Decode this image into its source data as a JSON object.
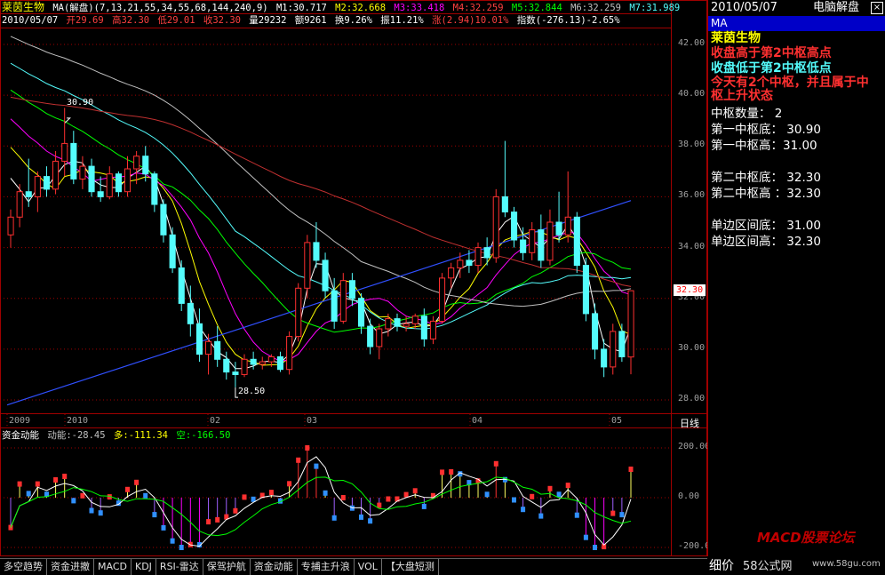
{
  "stock_name": "莱茵生物",
  "indicator_header": {
    "label": "MA(解盘)(7,13,21,55,34,55,68,144,240,9)",
    "m1": "M1:30.717",
    "m2": "M2:32.668",
    "m3": "M3:33.418",
    "m4": "M4:32.259",
    "m5": "M5:32.844",
    "m6": "M6:32.259",
    "m7": "M7:31.989"
  },
  "quote_line": {
    "date": "2010/05/07",
    "open": "开29.69",
    "high": "高32.30",
    "low": "低29.01",
    "close": "收32.30",
    "volume": "量29232",
    "amount": "额9261",
    "turnover": "换9.26%",
    "amplitude": "振11.21%",
    "change": "涨(2.94)10.01%",
    "index": "指数(-276.13)-2.65%"
  },
  "price_axis": [
    "42.00",
    "40.00",
    "38.00",
    "36.00",
    "34.00",
    "32.00",
    "30.00",
    "28.00"
  ],
  "current_price_tag": "32.30",
  "annotations": {
    "high_label": "30.90",
    "low_label": "28.50"
  },
  "time_axis": [
    "2009",
    "2010",
    "02",
    "03",
    "04",
    "05"
  ],
  "period_label": "日线",
  "sub_indicator": {
    "title": "资金动能",
    "power": "动能:-28.45",
    "bull": "多:-111.34",
    "bear": "空:-166.50",
    "axis": [
      "200.00",
      "0.00",
      "-200.00"
    ]
  },
  "sidebar": {
    "date": "2010/05/07",
    "title": "电脑解盘",
    "ma_label": "MA",
    "name_line": "莱茵生物",
    "msg1": "收盘高于第2中枢高点",
    "msg2": "收盘低于第2中枢低点",
    "msg3": "今天有2个中枢，并且属于中枢上升状态",
    "count": "中枢数量： 2",
    "c1_low": "第一中枢底： 30.90",
    "c1_high": "第一中枢高：31.00",
    "c2_low": "第二中枢底： 32.30",
    "c2_high": "第二中枢高   ：32.30",
    "side_low": "单边区间底： 31.00",
    "side_high": "单边区间高：  32.30",
    "detail": "细价"
  },
  "tabs": [
    "多空趋势",
    "资金进撤",
    "MACD",
    "KDJ",
    "RSI-雷达",
    "保驾护航",
    "资金动能",
    "专捕主升浪",
    "VOL",
    "【大盘短测"
  ],
  "watermark": {
    "forum": "MACD股票论坛",
    "site": "58公式网",
    "url": "www.58gu.com"
  },
  "colors": {
    "up": "#ff3030",
    "down": "#54fcfc",
    "grid": "#a00000"
  },
  "chart_data": {
    "type": "candlestick",
    "period": "日线",
    "y_axis": {
      "min": 28.0,
      "max": 42.0,
      "ticks": [
        28,
        30,
        32,
        34,
        36,
        38,
        40,
        42
      ]
    },
    "candles": [
      [
        34.5,
        35.5,
        34.0,
        35.2
      ],
      [
        35.2,
        36.5,
        34.8,
        36.2
      ],
      [
        36.2,
        37.5,
        35.6,
        36.0
      ],
      [
        36.0,
        37.0,
        35.4,
        36.8
      ],
      [
        36.8,
        37.2,
        36.0,
        36.3
      ],
      [
        36.3,
        37.8,
        36.1,
        37.4
      ],
      [
        37.4,
        39.5,
        36.8,
        38.1
      ],
      [
        38.1,
        38.6,
        36.5,
        36.7
      ],
      [
        36.7,
        37.6,
        36.3,
        37.2
      ],
      [
        37.2,
        37.5,
        36.0,
        36.2
      ],
      [
        36.2,
        36.8,
        35.8,
        36.0
      ],
      [
        36.0,
        37.2,
        35.9,
        36.9
      ],
      [
        36.9,
        37.0,
        36.0,
        36.2
      ],
      [
        36.2,
        37.6,
        36.0,
        37.1
      ],
      [
        37.1,
        37.8,
        36.5,
        37.6
      ],
      [
        37.6,
        38.0,
        36.6,
        36.9
      ],
      [
        36.9,
        37.0,
        35.4,
        35.7
      ],
      [
        35.7,
        35.9,
        34.2,
        34.5
      ],
      [
        34.5,
        34.8,
        33.0,
        33.2
      ],
      [
        33.2,
        33.5,
        31.5,
        31.8
      ],
      [
        31.8,
        32.5,
        30.5,
        31.0
      ],
      [
        31.0,
        31.6,
        29.5,
        29.8
      ],
      [
        29.8,
        30.6,
        29.0,
        30.3
      ],
      [
        30.3,
        30.9,
        29.3,
        29.6
      ],
      [
        29.6,
        29.9,
        28.8,
        29.1
      ],
      [
        29.1,
        29.5,
        28.5,
        29.0
      ],
      [
        29.0,
        29.8,
        28.9,
        29.6
      ],
      [
        29.6,
        29.9,
        29.2,
        29.4
      ],
      [
        29.4,
        29.7,
        29.2,
        29.5
      ],
      [
        29.5,
        29.8,
        29.3,
        29.7
      ],
      [
        29.7,
        29.9,
        29.1,
        29.2
      ],
      [
        29.2,
        30.7,
        29.0,
        30.5
      ],
      [
        30.5,
        32.6,
        30.3,
        32.4
      ],
      [
        32.4,
        34.5,
        32.0,
        34.2
      ],
      [
        34.2,
        35.0,
        33.2,
        33.5
      ],
      [
        33.5,
        33.8,
        32.0,
        32.3
      ],
      [
        32.3,
        32.8,
        30.8,
        31.1
      ],
      [
        31.1,
        33.0,
        31.0,
        32.7
      ],
      [
        32.7,
        33.0,
        31.7,
        32.0
      ],
      [
        32.0,
        32.2,
        30.6,
        30.9
      ],
      [
        30.9,
        31.2,
        29.8,
        30.1
      ],
      [
        30.1,
        31.0,
        29.6,
        30.8
      ],
      [
        30.8,
        31.4,
        30.5,
        31.2
      ],
      [
        31.2,
        31.4,
        30.7,
        30.9
      ],
      [
        30.9,
        31.3,
        30.7,
        31.0
      ],
      [
        31.0,
        31.4,
        30.8,
        31.3
      ],
      [
        31.3,
        31.6,
        30.1,
        30.4
      ],
      [
        30.4,
        31.3,
        30.2,
        31.1
      ],
      [
        31.1,
        33.0,
        31.0,
        32.8
      ],
      [
        32.8,
        33.4,
        32.4,
        33.2
      ],
      [
        33.2,
        33.8,
        32.8,
        33.5
      ],
      [
        33.5,
        33.9,
        33.0,
        33.3
      ],
      [
        33.3,
        34.2,
        33.0,
        34.0
      ],
      [
        34.0,
        34.4,
        33.3,
        33.6
      ],
      [
        33.6,
        36.3,
        33.4,
        36.0
      ],
      [
        36.0,
        38.2,
        35.2,
        35.4
      ],
      [
        35.4,
        35.6,
        34.0,
        34.3
      ],
      [
        34.3,
        34.8,
        33.5,
        33.8
      ],
      [
        33.8,
        35.0,
        33.5,
        34.7
      ],
      [
        34.7,
        35.3,
        33.2,
        33.5
      ],
      [
        33.5,
        35.5,
        33.3,
        35.0
      ],
      [
        35.0,
        36.2,
        34.2,
        34.5
      ],
      [
        34.5,
        37.0,
        34.2,
        35.2
      ],
      [
        35.2,
        35.4,
        33.0,
        33.3
      ],
      [
        33.3,
        33.6,
        31.1,
        31.4
      ],
      [
        31.4,
        31.8,
        29.6,
        30.0
      ],
      [
        30.0,
        30.4,
        28.9,
        29.3
      ],
      [
        29.3,
        31.0,
        29.0,
        30.7
      ],
      [
        30.7,
        31.0,
        29.5,
        29.7
      ],
      [
        29.69,
        32.3,
        29.01,
        32.3
      ]
    ],
    "moving_averages": {
      "M1": 30.717,
      "M2": 32.668,
      "M3": 33.418,
      "M4": 32.259,
      "M5": 32.844,
      "M6": 32.259,
      "M7": 31.989
    },
    "sub_chart": {
      "name": "资金动能",
      "power": -28.45,
      "bull": -111.34,
      "bear": -166.5,
      "y_axis": {
        "min": -200,
        "max": 200,
        "ticks": [
          200,
          0,
          -200
        ]
      }
    }
  }
}
